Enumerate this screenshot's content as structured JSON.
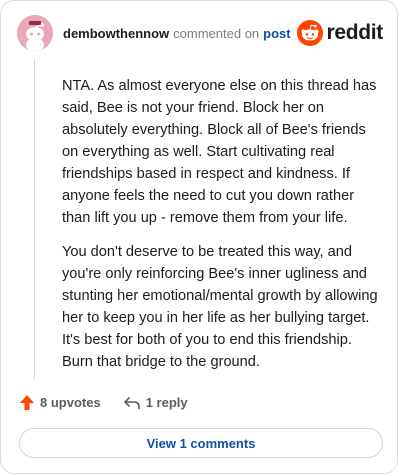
{
  "comment": {
    "author": "dembowthennow",
    "action_text": "commented on",
    "post_link": "post",
    "paragraphs": [
      "NTA. As almost everyone else on this thread has said, Bee is not your friend. Block her on absolutely everything. Block all of Bee's friends on everything as well. Start cultivating real friendships based in respect and kindness. If anyone feels the need to cut you down rather than lift you up - remove them from your life.",
      "You don't deserve to be treated this way, and you're only reinforcing Bee's inner ugliness and stunting her emotional/mental growth by allowing her to keep you in her life as her bullying target. It's best for both of you to end this friendship. Burn that bridge to the ground."
    ],
    "upvotes_label": "8 upvotes",
    "reply_label": "1 reply",
    "view_comments_label": "View 1 comments"
  },
  "brand": {
    "name": "reddit",
    "accent": "#ff4500",
    "link_color": "#0f4fa8"
  },
  "icons": {
    "avatar": "snoo-avatar-icon",
    "logo": "reddit-snoo-icon",
    "upvote": "upvote-arrow-icon",
    "reply": "reply-arrow-icon"
  }
}
